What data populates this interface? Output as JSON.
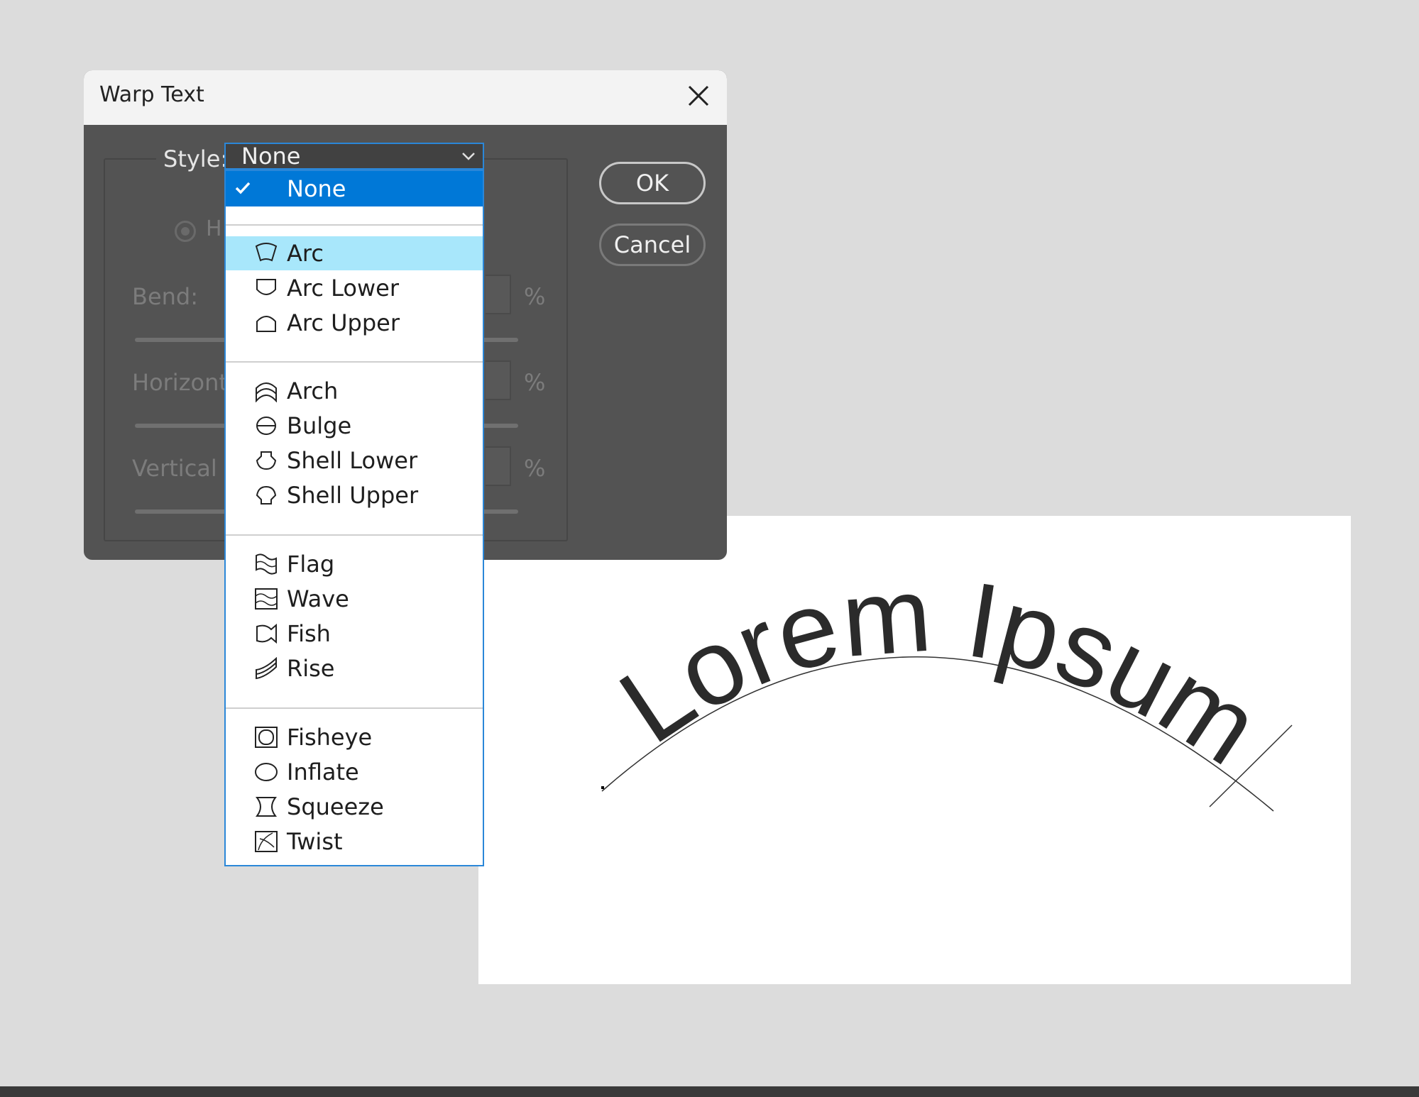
{
  "dialog": {
    "title": "Warp Text",
    "style_label": "Style:",
    "style_value": "None",
    "orientation_label_partial": "H",
    "bend_label_partial": "Bend:",
    "horizontal_label_partial": "Horizonta",
    "vertical_label_partial": "Vertical D",
    "percent_unit": "%",
    "ok_label": "OK",
    "cancel_label": "Cancel"
  },
  "dropdown": {
    "selected": "None",
    "hovered": "Arc",
    "groups": [
      [
        {
          "label": "None",
          "icon": "check-icon"
        }
      ],
      [
        {
          "label": "Arc",
          "icon": "arc-warp-icon"
        },
        {
          "label": "Arc Lower",
          "icon": "arc-lower-warp-icon"
        },
        {
          "label": "Arc Upper",
          "icon": "arc-upper-warp-icon"
        }
      ],
      [
        {
          "label": "Arch",
          "icon": "arch-warp-icon"
        },
        {
          "label": "Bulge",
          "icon": "bulge-warp-icon"
        },
        {
          "label": "Shell Lower",
          "icon": "shell-lower-warp-icon"
        },
        {
          "label": "Shell Upper",
          "icon": "shell-upper-warp-icon"
        }
      ],
      [
        {
          "label": "Flag",
          "icon": "flag-warp-icon"
        },
        {
          "label": "Wave",
          "icon": "wave-warp-icon"
        },
        {
          "label": "Fish",
          "icon": "fish-warp-icon"
        },
        {
          "label": "Rise",
          "icon": "rise-warp-icon"
        }
      ],
      [
        {
          "label": "Fisheye",
          "icon": "fisheye-warp-icon"
        },
        {
          "label": "Inflate",
          "icon": "inflate-warp-icon"
        },
        {
          "label": "Squeeze",
          "icon": "squeeze-warp-icon"
        },
        {
          "label": "Twist",
          "icon": "twist-warp-icon"
        }
      ]
    ]
  },
  "canvas": {
    "text": "Lorem Ipsum"
  },
  "colors": {
    "dialog_bg": "#535353",
    "titlebar_bg": "#f3f3f3",
    "selection": "#0078d7",
    "hover": "#a8e7fb",
    "focus_border": "#2b87d8"
  }
}
